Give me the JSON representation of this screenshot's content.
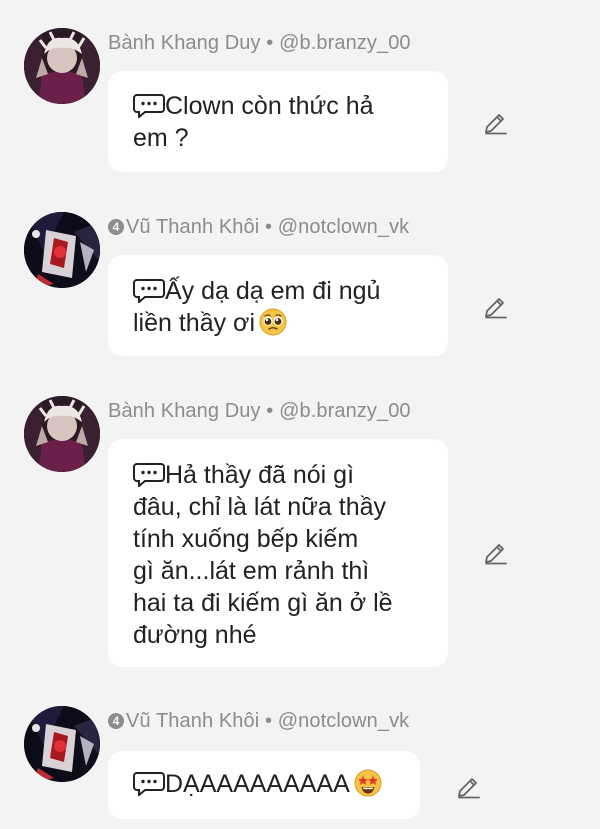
{
  "messages": [
    {
      "author": "Bành Khang Duy",
      "handle": "@b.branzy_00",
      "badge": "",
      "text": "Clown còn thức hả\nem ?",
      "emoji": "",
      "edit_icon": "pencil-icon"
    },
    {
      "author": "Vũ Thanh Khôi",
      "handle": "@notclown_vk",
      "badge": "4",
      "text": "Ấy dạ dạ em đi ngủ\nliền thầy ơi",
      "emoji": "pleading-face",
      "edit_icon": "pencil-icon"
    },
    {
      "author": "Bành Khang Duy",
      "handle": "@b.branzy_00",
      "badge": "",
      "text": "Hả thầy đã nói gì\nđâu, chỉ là lát nữa thầy\ntính xuống bếp kiếm\ngì ăn...lát em rảnh thì\nhai ta đi kiếm gì ăn ở lề\nđường nhé",
      "emoji": "",
      "edit_icon": "pencil-icon"
    },
    {
      "author": "Vũ Thanh Khôi",
      "handle": "@notclown_vk",
      "badge": "4",
      "text": "DẠAAAAAAAAA",
      "emoji": "star-struck",
      "edit_icon": "pencil-icon"
    }
  ],
  "separator": "•",
  "colors": {
    "background": "#f3f3f3",
    "bubble": "#ffffff",
    "text": "#222222",
    "meta": "#8c8c8c"
  }
}
